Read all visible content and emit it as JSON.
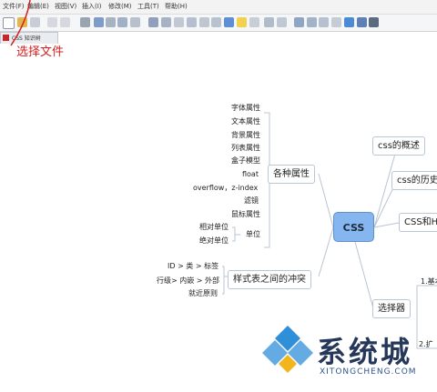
{
  "menu": [
    "文件(F)",
    "编辑(E)",
    "视图(V)",
    "插入(I)",
    "修改(M)",
    "工具(T)",
    "帮助(H)"
  ],
  "doc_tab": {
    "label": "CSS 知识树"
  },
  "annotation": "选择文件",
  "mindmap": {
    "center": "CSS",
    "right_branches": [
      "css的概述",
      "css的历史",
      "CSS和H",
      "选择器"
    ],
    "selector_children": [
      "1.基本",
      "2.扩"
    ],
    "props_branch": {
      "label": "各种属性",
      "children": [
        "字体属性",
        "文本属性",
        "背景属性",
        "列表属性",
        "盒子模型",
        "float",
        "overflow，z-index",
        "滤镜",
        "鼠标属性"
      ],
      "unit": {
        "label": "单位",
        "children": [
          "相对单位",
          "绝对单位"
        ]
      }
    },
    "conflict_branch": {
      "label": "样式表之间的冲突",
      "children": [
        "ID > 类 > 标签",
        "行级> 内嵌 > 外部",
        "就近原则"
      ]
    }
  },
  "watermark": {
    "text": "系统城",
    "url": "XITONGCHENG.COM"
  }
}
